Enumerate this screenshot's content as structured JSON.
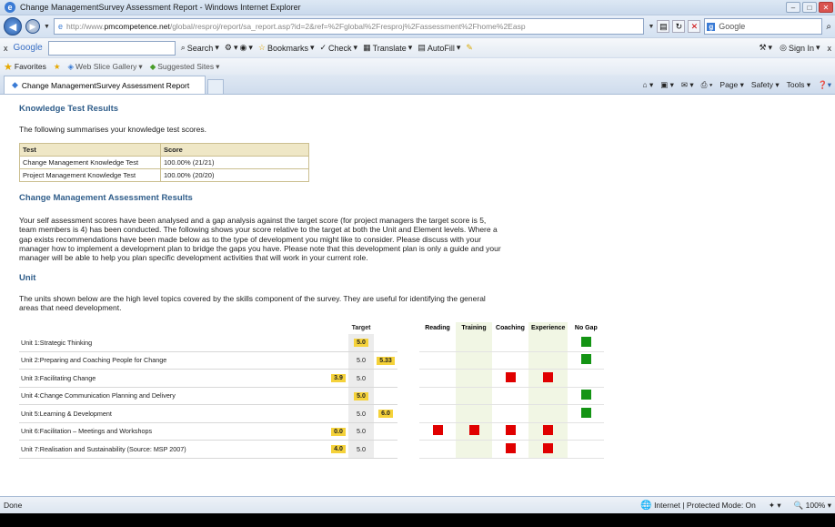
{
  "window": {
    "title": "Change ManagementSurvey Assessment Report - Windows Internet Explorer"
  },
  "address": {
    "url_prefix": "http://www.",
    "url_domain": "pmcompetence.net",
    "url_rest": "/global/resproj/report/sa_report.asp?id=2&ref=%2Fglobal%2Fresproj%2Fassessment%2Fhome%2Easp",
    "search_engine": "Google"
  },
  "google_toolbar": {
    "logo": "Google",
    "items": [
      "Search",
      "Bookmarks",
      "Check",
      "Translate",
      "AutoFill"
    ],
    "signin": "Sign In"
  },
  "favorites_bar": {
    "favorites": "Favorites",
    "web_slice": "Web Slice Gallery",
    "suggested": "Suggested Sites"
  },
  "tab": {
    "label": "Change ManagementSurvey Assessment Report"
  },
  "command_bar": {
    "page": "Page",
    "safety": "Safety",
    "tools": "Tools"
  },
  "content": {
    "knowledge_heading": "Knowledge Test Results",
    "knowledge_intro": "The following summarises your knowledge test scores.",
    "knowledge_table": {
      "headers": [
        "Test",
        "Score"
      ],
      "rows": [
        [
          "Change Management Knowledge Test",
          "100.00% (21/21)"
        ],
        [
          "Project Management Knowledge Test",
          "100.00% (20/20)"
        ]
      ]
    },
    "assessment_heading": "Change Management Assessment Results",
    "assessment_p1": "Your self assessment scores have been analysed and a gap analysis against the target score (for project managers the target score is 5,",
    "assessment_p2": "team members is 4) has been conducted. The following shows your score relative to the target at both the Unit and Element levels. Where a",
    "assessment_p3": "gap exists recommendations have been made below as to the type of development you might like to consider. Please discuss with your",
    "assessment_p4": "manager how to implement a development plan to bridge the gaps you have. Please note that this development plan is only a guide and your",
    "assessment_p5": "manager will be able to help you plan specific development activities that will work in your current role.",
    "unit_heading": "Unit",
    "unit_intro1": "The units shown below are the high level topics covered by the skills component of the survey. They are useful for identifying the general",
    "unit_intro2": "areas that need development.",
    "target_header": "Target",
    "gap_headers": [
      "Reading",
      "Training",
      "Coaching",
      "Experience",
      "No Gap"
    ],
    "units": [
      {
        "name": "Unit 1:Strategic Thinking",
        "score": "",
        "target": "5.0",
        "current": "",
        "target_highlight": true,
        "gaps": [
          0,
          0,
          0,
          0,
          1
        ]
      },
      {
        "name": "Unit 2:Preparing and Coaching People for Change",
        "score": "",
        "target": "5.0",
        "current": "5.33",
        "target_highlight": false,
        "gaps": [
          0,
          0,
          0,
          0,
          1
        ]
      },
      {
        "name": "Unit 3:Facilitating Change",
        "score": "3.9",
        "target": "5.0",
        "current": "",
        "target_highlight": false,
        "gaps": [
          0,
          0,
          1,
          1,
          0
        ]
      },
      {
        "name": "Unit 4:Change Communication Planning and Delivery",
        "score": "",
        "target": "5.0",
        "current": "",
        "target_highlight": true,
        "gaps": [
          0,
          0,
          0,
          0,
          1
        ]
      },
      {
        "name": "Unit 5:Learning & Development",
        "score": "",
        "target": "5.0",
        "current": "6.0",
        "target_highlight": false,
        "gaps": [
          0,
          0,
          0,
          0,
          1
        ]
      },
      {
        "name": "Unit 6:Facilitation – Meetings and Workshops",
        "score": "0.0",
        "target": "5.0",
        "current": "",
        "target_highlight": false,
        "gaps": [
          1,
          1,
          1,
          1,
          0
        ]
      },
      {
        "name": "Unit 7:Realisation and Sustainability (Source: MSP 2007)",
        "score": "4.0",
        "target": "5.0",
        "current": "",
        "target_highlight": false,
        "gaps": [
          0,
          0,
          1,
          1,
          0
        ]
      }
    ]
  },
  "status": {
    "left": "Done",
    "zone": "Internet | Protected Mode: On",
    "zoom": "100%"
  },
  "colors": {
    "red": "#e00000",
    "green": "#149414",
    "badge": "#f5d23a",
    "heading": "#2f5d8a"
  }
}
